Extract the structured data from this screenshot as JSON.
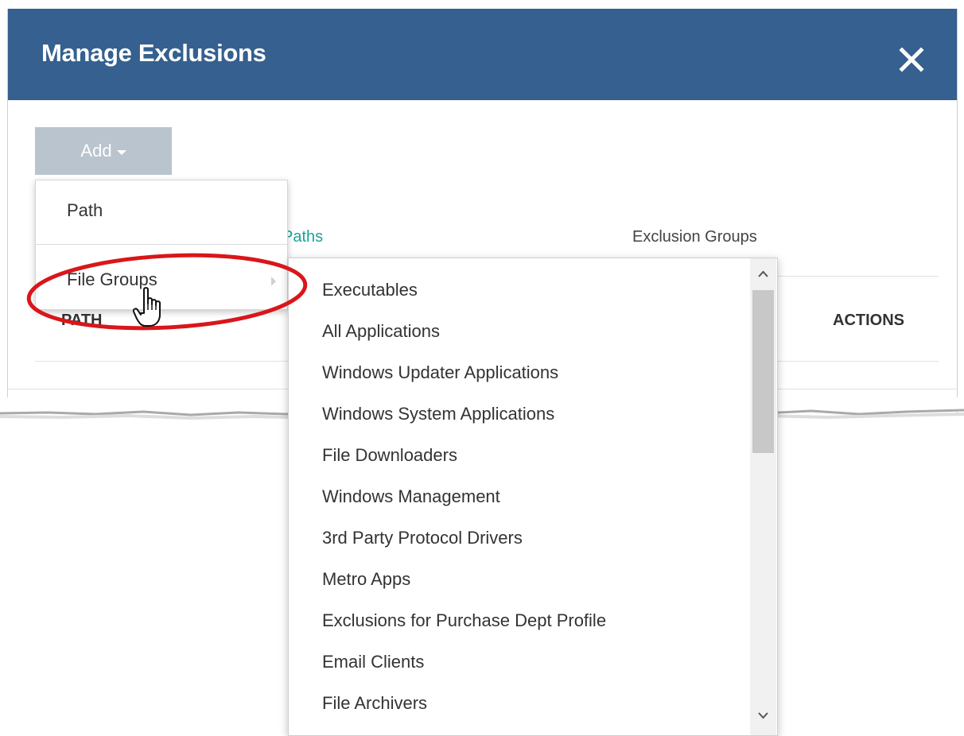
{
  "dialog": {
    "title": "Manage Exclusions",
    "header_color": "#35608f",
    "close_icon": "close-icon"
  },
  "toolbar": {
    "add_label": "Add",
    "add_button_color": "#b9c4cf"
  },
  "tabs": [
    {
      "label": "Paths",
      "active": true,
      "color": "#1aa39a"
    },
    {
      "label": "Exclusion Groups",
      "active": false
    }
  ],
  "table": {
    "columns": [
      "PATH",
      "ACTIONS"
    ]
  },
  "add_menu": {
    "items": [
      {
        "label": "Path"
      },
      {
        "label": "File Groups",
        "has_submenu": true,
        "hovered": true
      }
    ]
  },
  "file_groups_submenu": {
    "items": [
      "Executables",
      "All Applications",
      "Windows Updater Applications",
      "Windows System Applications",
      "File Downloaders",
      "Windows Management",
      "3rd Party Protocol Drivers",
      "Metro Apps",
      "Exclusions for Purchase Dept Profile",
      "Email Clients",
      "File Archivers"
    ]
  },
  "annotation": {
    "highlight_color": "#d9161b",
    "cursor": "hand-pointer-icon"
  }
}
